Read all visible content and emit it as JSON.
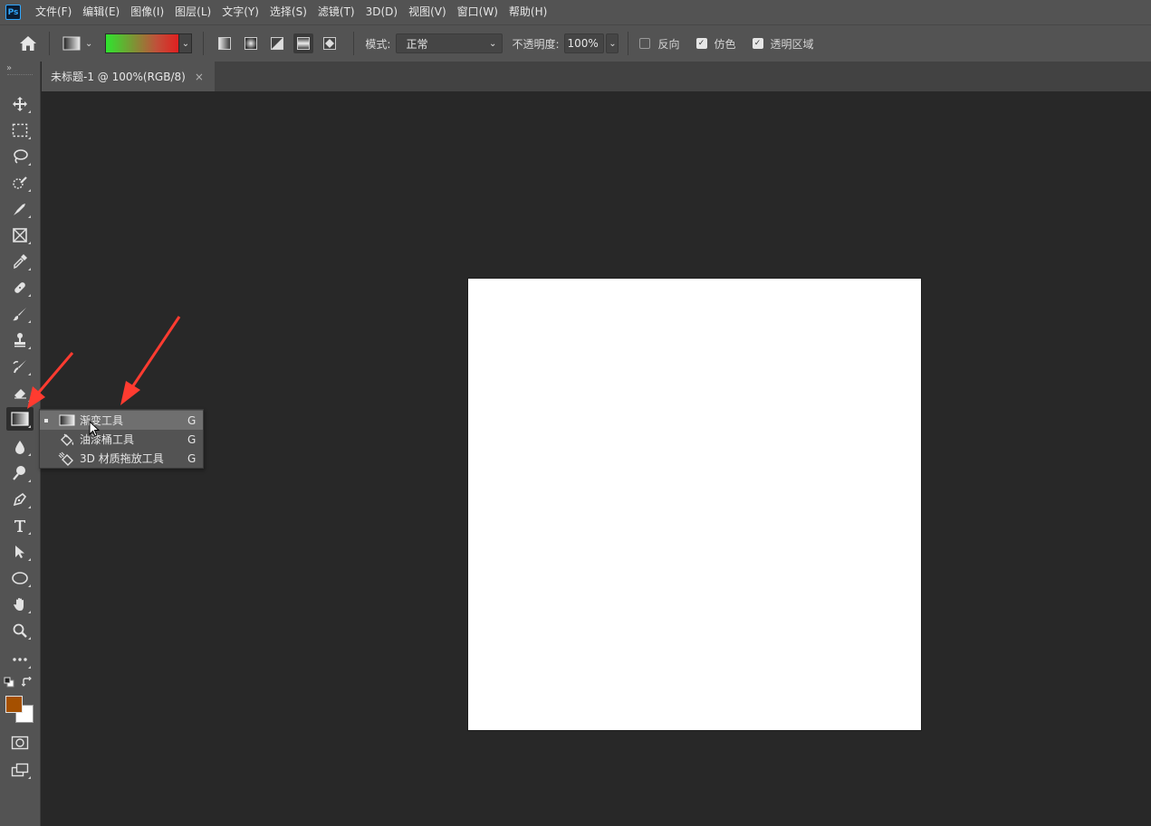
{
  "app": {
    "logo_text": "Ps"
  },
  "menubar": {
    "items": [
      "文件(F)",
      "编辑(E)",
      "图像(I)",
      "图层(L)",
      "文字(Y)",
      "选择(S)",
      "滤镜(T)",
      "3D(D)",
      "视图(V)",
      "窗口(W)",
      "帮助(H)"
    ]
  },
  "options": {
    "gradient_colors": [
      "#2ee52e",
      "#e02020"
    ],
    "gradient_types": [
      "linear-gradient-icon",
      "radial-gradient-icon",
      "angle-gradient-icon",
      "reflected-gradient-icon",
      "diamond-gradient-icon"
    ],
    "active_gradient_type": "reflected-gradient-icon",
    "mode_label": "模式:",
    "mode_value": "正常",
    "opacity_label": "不透明度:",
    "opacity_value": "100%",
    "reverse_label": "反向",
    "reverse_checked": false,
    "dither_label": "仿色",
    "dither_checked": true,
    "transparency_label": "透明区域",
    "transparency_checked": true
  },
  "document": {
    "tab_title": "未标题-1 @ 100%(RGB/8)",
    "tab_close": "×",
    "canvas_color": "#ffffff"
  },
  "toolbar": {
    "collapse_glyph": "»",
    "tools": [
      "move-tool",
      "marquee-tool",
      "lasso-tool",
      "quick-select-tool",
      "crop-tool",
      "frame-tool",
      "eyedropper-tool",
      "healing-brush-tool",
      "brush-tool",
      "clone-stamp-tool",
      "history-brush-tool",
      "eraser-tool",
      "gradient-tool",
      "blur-tool",
      "dodge-tool",
      "pen-tool",
      "type-tool",
      "path-select-tool",
      "ellipse-tool",
      "hand-tool",
      "zoom-tool",
      "edit-toolbar"
    ],
    "active_tool": "gradient-tool",
    "foreground_color": "#a55000",
    "background_color": "#ffffff"
  },
  "flyout": {
    "items": [
      {
        "label": "渐变工具",
        "shortcut": "G",
        "selected": true,
        "icon": "gradient-icon"
      },
      {
        "label": "油漆桶工具",
        "shortcut": "G",
        "selected": false,
        "icon": "paint-bucket-icon"
      },
      {
        "label": "3D 材质拖放工具",
        "shortcut": "G",
        "selected": false,
        "icon": "3d-material-drop-icon"
      }
    ]
  },
  "annotations": {
    "arrow_color": "#ff3b30"
  }
}
